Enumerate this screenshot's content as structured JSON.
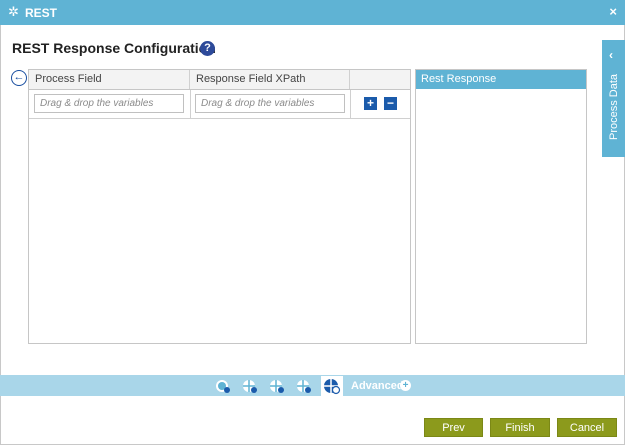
{
  "window": {
    "title": "REST",
    "close_symbol": "×",
    "gear_symbol": "✲"
  },
  "page": {
    "heading": "REST Response Configuration",
    "help_symbol": "?"
  },
  "grid": {
    "columns": [
      "Process Field",
      "Response Field XPath",
      ""
    ],
    "rows": [
      {
        "process_field_placeholder": "Drag & drop the variables",
        "xpath_placeholder": "Drag & drop the variables"
      }
    ],
    "add_symbol": "+",
    "remove_symbol": "−"
  },
  "response_panel": {
    "title": "Rest Response"
  },
  "side_tab": {
    "label": "Process Data",
    "chevron": "‹"
  },
  "bottom_toolbar": {
    "icons": [
      "globe-settings-icon",
      "globe-request-icon",
      "globe-header-icon",
      "globe-auth-icon",
      "globe-response-icon"
    ],
    "advanced_label": "Advanced",
    "advanced_symbol": "+"
  },
  "buttons": {
    "prev": "Prev",
    "finish": "Finish",
    "cancel": "Cancel"
  },
  "colors": {
    "accent": "#5fb3d4",
    "button": "#8c9a1c",
    "icon_blue": "#1b5bab"
  }
}
